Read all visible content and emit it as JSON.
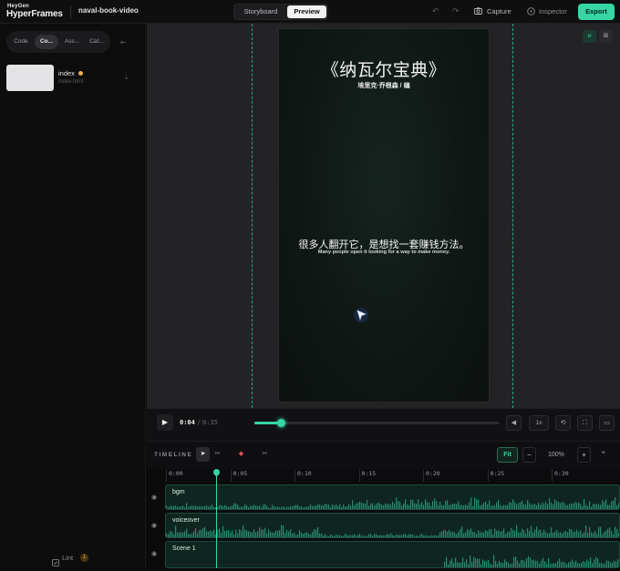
{
  "app": {
    "brand_small": "HeyGen",
    "brand_big": "HyperFrames",
    "project": "naval-book-video"
  },
  "header": {
    "tabs": [
      {
        "label": "Storyboard"
      },
      {
        "label": "Preview"
      }
    ],
    "capture_label": "Capture",
    "inspector_label": "Inspector",
    "export_label": "Export"
  },
  "sidebar": {
    "tabs": [
      {
        "label": "Code"
      },
      {
        "label": "Co..."
      },
      {
        "label": "Ass..."
      },
      {
        "label": "Cat..."
      }
    ],
    "composition": {
      "name": "index",
      "file": "index.html"
    },
    "lint_label": "Lint",
    "lint_count": "1"
  },
  "preview": {
    "title": "《纳瓦尔宝典》",
    "author": "埃里克·乔根森 / 编",
    "subtitle_zh": "很多人翻开它，是想找一套赚钱方法。",
    "subtitle_en": "Many people open it looking for a way to make money."
  },
  "playback": {
    "current": "0:04",
    "separator": "/",
    "total": "0:35",
    "progress": 0.11,
    "speed": "1x"
  },
  "timeline": {
    "label": "TIMELINE",
    "fit_label": "Fit",
    "zoom": "100%",
    "ticks": [
      "0:00",
      "0:05",
      "0:10",
      "0:15",
      "0:20",
      "0:25",
      "0:30"
    ],
    "tracks": [
      {
        "name": "bgm"
      },
      {
        "name": "voiceover"
      },
      {
        "name": "Scene 1"
      }
    ]
  },
  "colors": {
    "accent": "#35d6a3",
    "warning": "#e8b24c"
  }
}
